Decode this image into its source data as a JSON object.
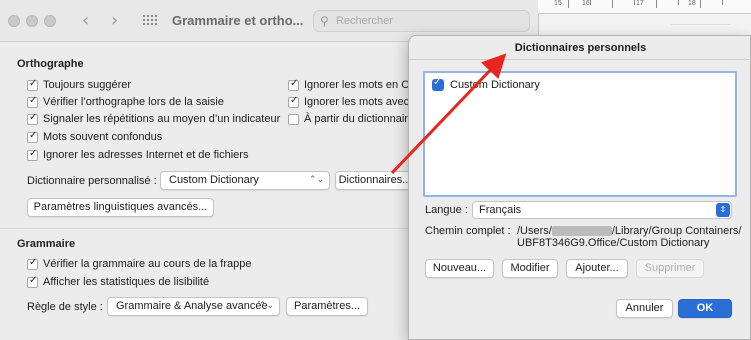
{
  "window": {
    "title": "Grammaire et ortho...",
    "search_placeholder": "Rechercher"
  },
  "orthographe": {
    "section_title": "Orthographe",
    "left_options": [
      {
        "label": "Toujours suggérer",
        "checked": true
      },
      {
        "label": "Vérifier l’orthographe lors de la saisie",
        "checked": true
      },
      {
        "label": "Signaler les répétitions au moyen d’un indicateur",
        "checked": true
      },
      {
        "label": "Mots souvent confondus",
        "checked": true
      },
      {
        "label": "Ignorer les adresses Internet et de fichiers",
        "checked": true
      }
    ],
    "right_options": [
      {
        "label": "Ignorer les mots en CA",
        "checked": true
      },
      {
        "label": "Ignorer les mots avec",
        "checked": true
      },
      {
        "label": "À partir du dictionnair",
        "checked": false
      }
    ],
    "custom_dict_label": "Dictionnaire personnalisé :",
    "custom_dict_value": "Custom Dictionary",
    "dictionaries_button": "Dictionnaires...",
    "advanced_button": "Paramètres linguistiques avancés..."
  },
  "grammaire": {
    "section_title": "Grammaire",
    "options": [
      {
        "label": "Vérifier la grammaire au cours de la frappe",
        "checked": true
      },
      {
        "label": "Afficher les statistiques de lisibilité",
        "checked": true
      }
    ],
    "style_rule_label": "Règle de style :",
    "style_rule_value": "Grammaire & Analyse avancée",
    "settings_button": "Paramètres..."
  },
  "dialog": {
    "title": "Dictionnaires personnels",
    "list_items": [
      {
        "label": "Custom Dictionary",
        "checked": true
      }
    ],
    "language_label": "Langue :",
    "language_value": "Français",
    "path_label": "Chemin complet :",
    "path_line1_prefix": "/Users/",
    "path_line1_suffix": "/Library/Group Containers/",
    "path_line2": "UBF8T346G9.Office/Custom Dictionary",
    "new_button": "Nouveau...",
    "edit_button": "Modifier",
    "add_button": "Ajouter...",
    "delete_button": "Supprimer",
    "cancel_button": "Annuler",
    "ok_button": "OK"
  },
  "ruler": {
    "numbers": [
      "15",
      "16",
      "17",
      "18"
    ]
  },
  "colors": {
    "accent": "#2b6fd6",
    "annotation_arrow": "#e8261f"
  }
}
